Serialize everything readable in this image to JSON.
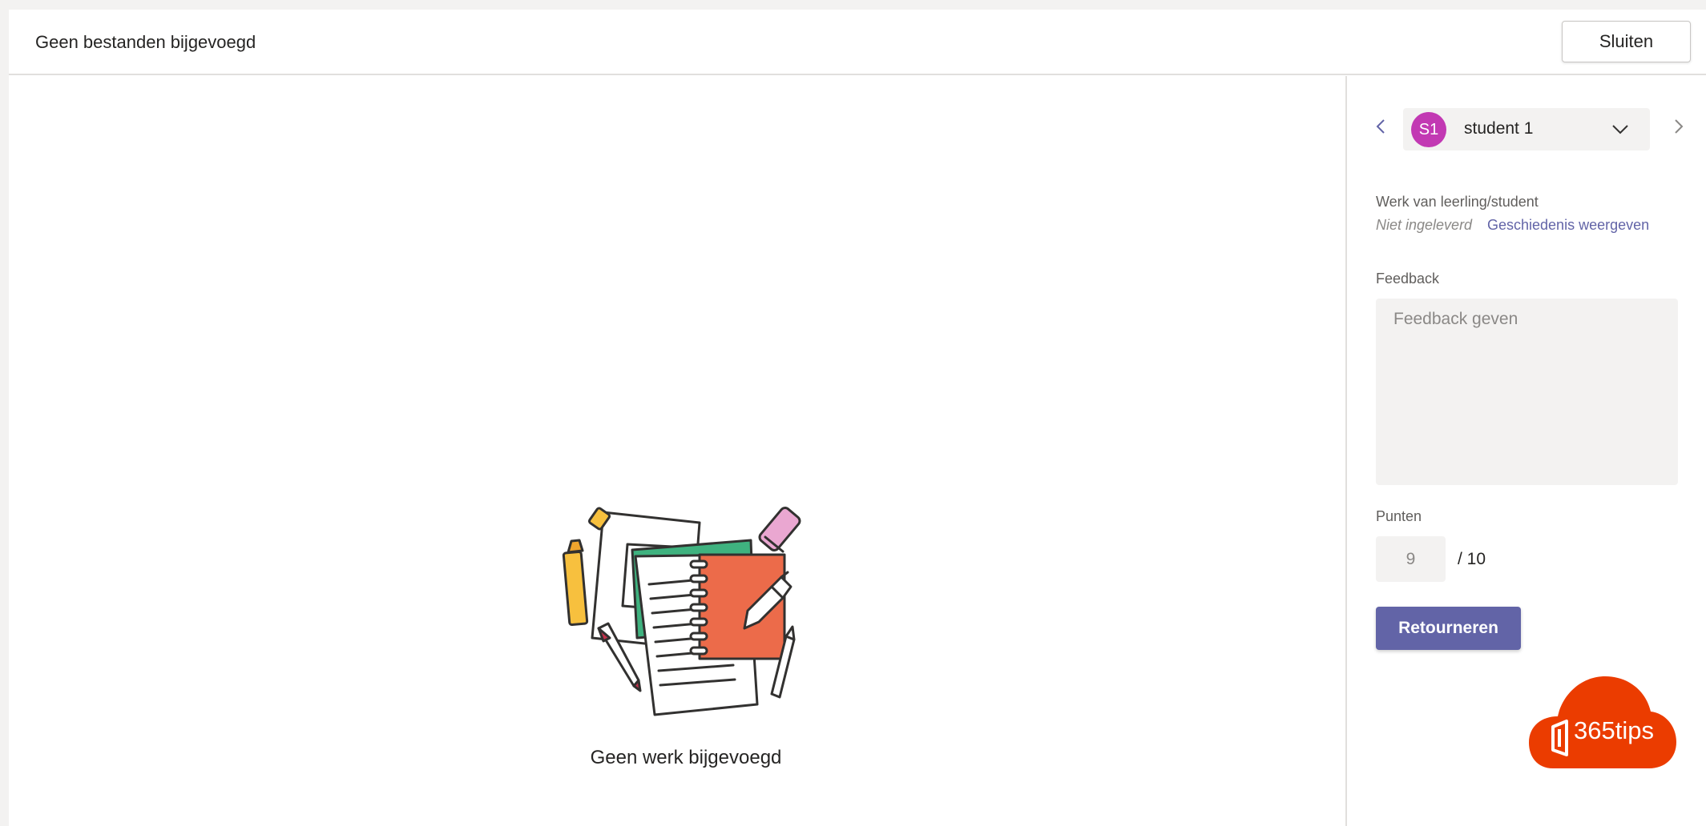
{
  "header": {
    "title": "Geen bestanden bijgevoegd",
    "close_label": "Sluiten"
  },
  "main": {
    "empty_message": "Geen werk bijgevoegd",
    "illustration": "notebook-illustration"
  },
  "sidebar": {
    "student": {
      "initials": "S1",
      "name": "student 1",
      "avatar_color": "#c239b3"
    },
    "work_label": "Werk van leerling/student",
    "status": "Niet ingeleverd",
    "history_link": "Geschiedenis weergeven",
    "feedback_label": "Feedback",
    "feedback_placeholder": "Feedback geven",
    "feedback_value": "",
    "points_label": "Punten",
    "points_value": "9",
    "points_max": "/ 10",
    "return_label": "Retourneren"
  },
  "logo": {
    "text": "365tips",
    "color": "#eb3c00"
  },
  "colors": {
    "accent": "#6264a7",
    "background": "#f3f2f1"
  },
  "icons": [
    "chevron-left-icon",
    "chevron-right-icon",
    "chevron-down-icon",
    "office-icon"
  ]
}
